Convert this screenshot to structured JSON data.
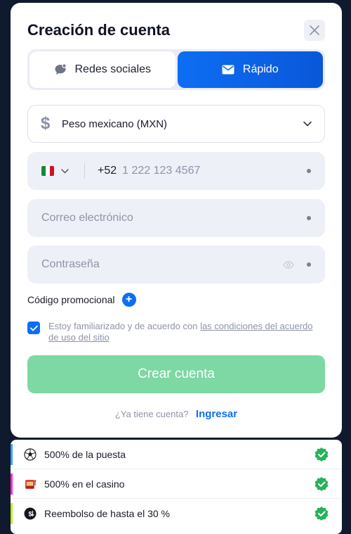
{
  "modal": {
    "title": "Creación de cuenta",
    "tabs": [
      {
        "label": "Redes sociales",
        "icon": "chat-bubble-icon",
        "active": false
      },
      {
        "label": "Rápido",
        "icon": "envelope-icon",
        "active": true
      }
    ],
    "currency": {
      "symbol": "$",
      "value": "Peso mexicano (MXN)"
    },
    "phone": {
      "country_flag": "mexico-flag",
      "prefix": "+52",
      "placeholder": "1 222 123 4567"
    },
    "email": {
      "placeholder": "Correo electrónico"
    },
    "password": {
      "placeholder": "Contraseña"
    },
    "promo": {
      "label": "Código promocional",
      "add": "+"
    },
    "terms": {
      "checked": true,
      "text": "Estoy familiarizado y de acuerdo con ",
      "link": "las condiciones del acuerdo de uso del sitio"
    },
    "submit": "Crear cuenta",
    "login": {
      "question": "¿Ya tiene cuenta?",
      "link": "Ingresar"
    }
  },
  "bonuses": [
    {
      "text": "500% de la puesta",
      "icon": "soccer-ball-icon",
      "bar_color": "#3aa0ff"
    },
    {
      "text": "500% en el casino",
      "icon": "slot-machine-icon",
      "bar_color": "#ff2ad4"
    },
    {
      "text": "Reembolso de hasta el 30 %",
      "icon": "cashback-icon",
      "bar_color": "#b6f21a"
    }
  ],
  "colors": {
    "accent": "#0d6ef3",
    "submit_disabled": "#7dd8a3",
    "success": "#25b35a"
  }
}
